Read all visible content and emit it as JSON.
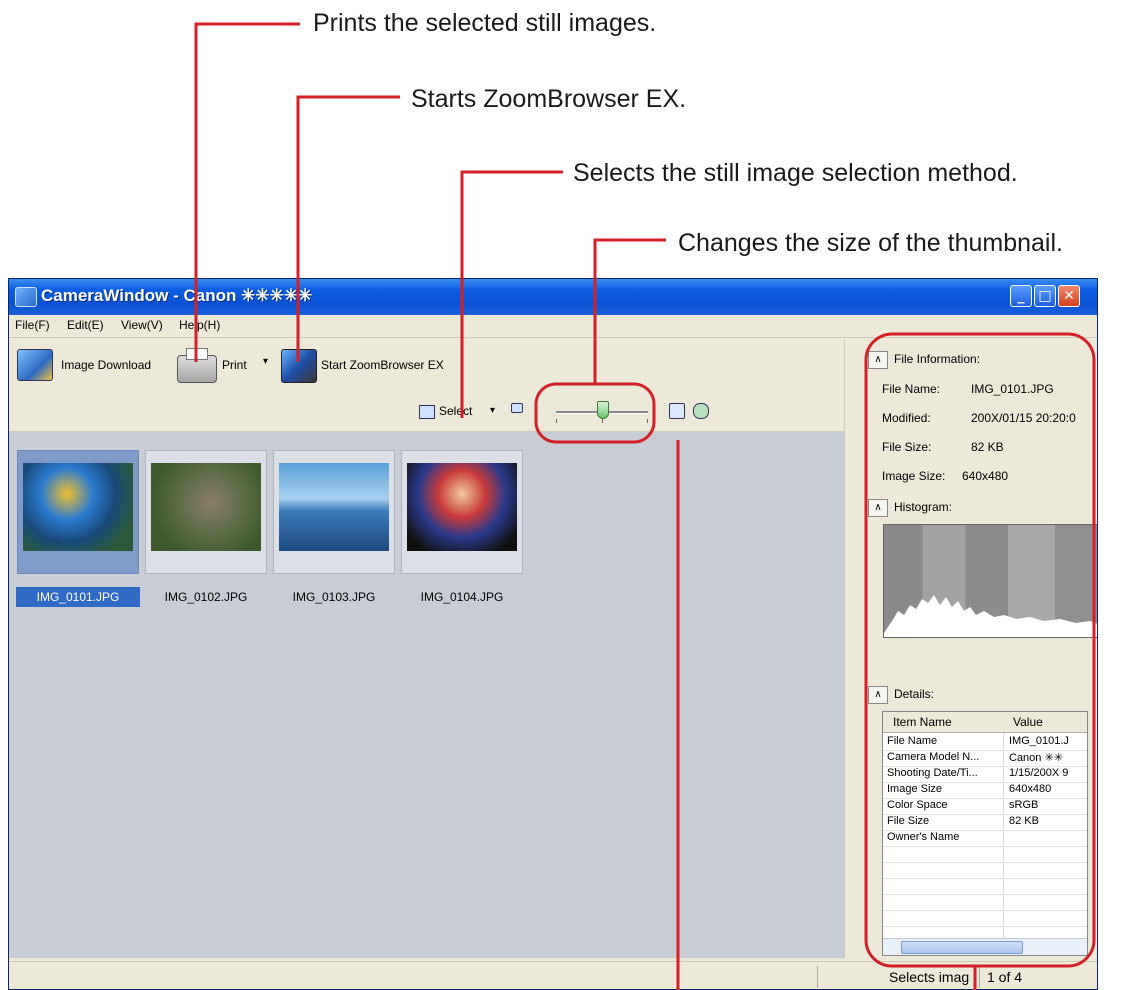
{
  "callouts": {
    "print": "Prints the selected still images.",
    "zoombrowser": "Starts ZoomBrowser EX.",
    "select": "Selects the still image selection method.",
    "thumb_size": "Changes the size of the thumbnail."
  },
  "window": {
    "title": "CameraWindow - Canon ✳✳✳✳✳",
    "min": "_",
    "max": "□",
    "close": "✕"
  },
  "menu": [
    "File(F)",
    "Edit(E)",
    "View(V)",
    "Help(H)"
  ],
  "toolbar": {
    "download_label": "Image Download",
    "print_label": "Print",
    "print_caret": "▾",
    "zoombrowser_label": "Start ZoomBrowser EX"
  },
  "controls": {
    "select_label": "Select",
    "select_caret": "▾",
    "thumb_size_level": 0.5
  },
  "thumbnails": [
    {
      "name": "IMG_0101.JPG",
      "selected": true
    },
    {
      "name": "IMG_0102.JPG",
      "selected": false
    },
    {
      "name": "IMG_0103.JPG",
      "selected": false
    },
    {
      "name": "IMG_0104.JPG",
      "selected": false
    }
  ],
  "panel": {
    "file_info_title": "File Information:",
    "file_info": [
      {
        "key": "File Name:",
        "value": "IMG_0101.JPG"
      },
      {
        "key": "Modified:",
        "value": "200X/01/15 20:20:0"
      },
      {
        "key": "File Size:",
        "value": "82 KB"
      },
      {
        "key": "Image Size:",
        "value": "640x480"
      }
    ],
    "histogram_title": "Histogram:",
    "details_title": "Details:",
    "collapse_glyph": "∧",
    "details_headers": [
      "Item Name",
      "Value"
    ],
    "details_rows": [
      {
        "name": "File Name",
        "value": "IMG_0101.J"
      },
      {
        "name": "Camera Model N...",
        "value": "Canon ✳✳"
      },
      {
        "name": "Shooting Date/Ti...",
        "value": "1/15/200X 9"
      },
      {
        "name": "Image Size",
        "value": "640x480"
      },
      {
        "name": "Color Space",
        "value": "sRGB"
      },
      {
        "name": "File Size",
        "value": "82 KB"
      },
      {
        "name": "Owner's Name",
        "value": ""
      }
    ]
  },
  "status": {
    "hint": "Selects imag",
    "count": "1 of 4"
  },
  "colors": {
    "callout_line": "#d42027",
    "titlebar": "#0a52d4",
    "selection": "#316ac5"
  }
}
